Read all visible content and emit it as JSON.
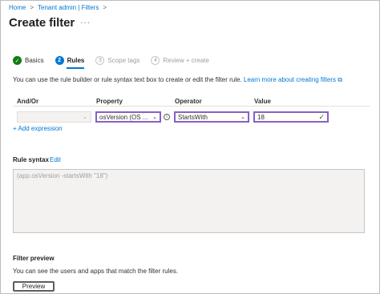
{
  "breadcrumb": {
    "home": "Home",
    "tenant": "Tenant admin | Filters",
    "sep": ">"
  },
  "page": {
    "title": "Create filter",
    "more": "···"
  },
  "steps": [
    {
      "label": "Basics",
      "icon": "✓",
      "state": "done"
    },
    {
      "label": "Rules",
      "icon": "2",
      "state": "active"
    },
    {
      "label": "Scope tags",
      "icon": "3",
      "state": "pending"
    },
    {
      "label": "Review + create",
      "icon": "4",
      "state": "pending"
    }
  ],
  "description": {
    "text": "You can use the rule builder or rule syntax text box to create or edit the filter rule.",
    "link": "Learn more about creating filters",
    "link_icon": "⧉"
  },
  "table": {
    "headers": {
      "and_or": "And/Or",
      "property": "Property",
      "operator": "Operator",
      "value": "Value"
    },
    "row": {
      "and_or": "",
      "property": "osVersion (OS ...",
      "operator": "StartsWith",
      "value": "18"
    },
    "add_expression": "+ Add expression"
  },
  "rule_syntax": {
    "title": "Rule syntax",
    "edit": "Edit",
    "value": "(app.osVersion -startsWith \"18\")"
  },
  "filter_preview": {
    "title": "Filter preview",
    "text": "You can see the users and apps that match the filter rules.",
    "button": "Preview"
  },
  "colors": {
    "accent": "#0078d4",
    "success": "#107c10",
    "focus": "#8661c5"
  }
}
